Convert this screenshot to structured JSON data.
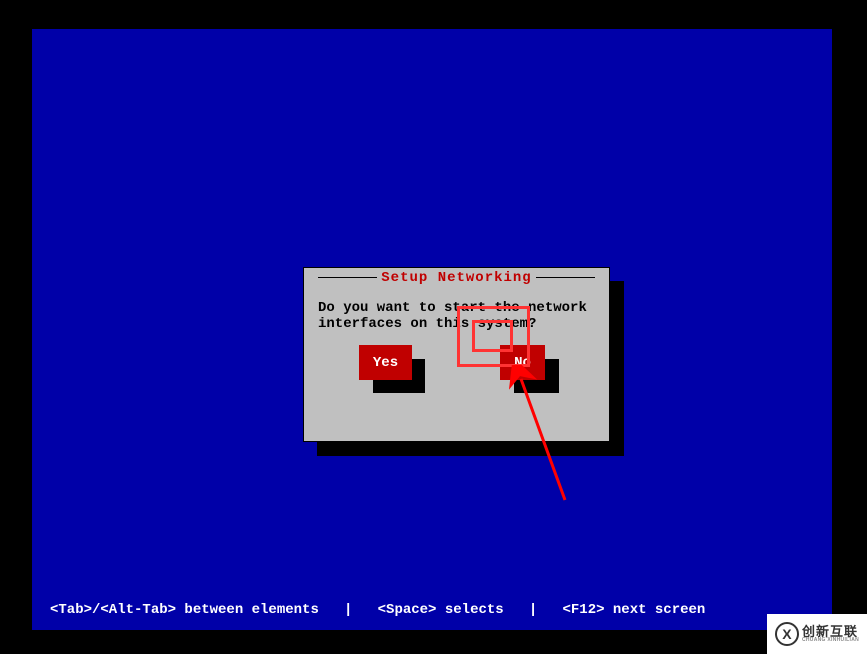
{
  "dialog": {
    "title": "Setup Networking",
    "message": "Do you want to start the network\n interfaces on this system?",
    "yes_label": "Yes",
    "no_label": "No"
  },
  "status_bar": {
    "text": "<Tab>/<Alt-Tab> between elements   |   <Space> selects   |   <F12> next screen"
  },
  "watermark": {
    "main": "创新互联",
    "sub": "CHUANG XINHUILIAN",
    "icon_glyph": "X"
  },
  "colors": {
    "screen_bg": "#0000a8",
    "dialog_bg": "#c0c0c0",
    "button_bg": "#c00000",
    "title_color": "#c00000",
    "highlight": "#ff3333"
  }
}
